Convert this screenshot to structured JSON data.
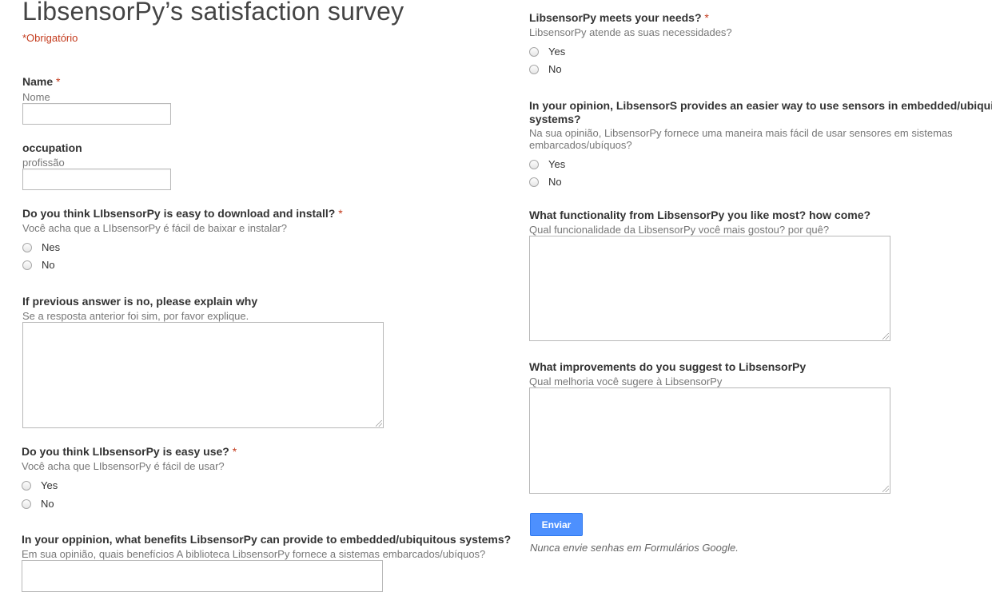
{
  "form": {
    "title": "LibsensorPy’s satisfaction survey",
    "required_note": "*Obrigatório",
    "required_star": "*",
    "left": {
      "name": {
        "label": "Name",
        "help": "Nome"
      },
      "occupation": {
        "label": "occupation",
        "help": "profissão"
      },
      "easy_install": {
        "label": "Do you think LIbsensorPy is easy to download and install?",
        "help": "Você acha que a LIbsensorPy é fácil de baixar e instalar?",
        "options": [
          "Nes",
          "No"
        ]
      },
      "explain_why": {
        "label": "If previous answer is no, please explain why",
        "help": "Se a resposta anterior foi sim, por favor explique."
      },
      "easy_use": {
        "label": "Do you think LIbsensorPy is easy use?",
        "help": "Você acha que LIbsensorPy é fácil de usar?",
        "options": [
          "Yes",
          "No"
        ]
      },
      "benefits": {
        "label": "In your oppinion, what benefits LibsensorPy can provide to embedded/ubiquitous systems?",
        "help": "Em sua opinião, quais benefícios A biblioteca LibsensorPy fornece a sistemas embarcados/ubíquos?"
      }
    },
    "right": {
      "meets_needs": {
        "label": "LibsensorPy meets your needs?",
        "help": "LibsensorPy atende as suas necessidades?",
        "options": [
          "Yes",
          "No"
        ]
      },
      "easier_way": {
        "label_line1": "In your opinion, LibsensorS provides an easier way to use sensors in embedded/ubiquitous",
        "label_line2": "systems?",
        "help_line1": "Na sua opinião, LibsensorPy fornece uma maneira mais fácil de usar sensores em sistemas",
        "help_line2": "embarcados/ubíquos?",
        "options": [
          "Yes",
          "No"
        ]
      },
      "functionality": {
        "label": "What functionality from LibsensorPy you like most? how come?",
        "help": "Qual funcionalidade da LibsensorPy você mais gostou? por quê?"
      },
      "improvements": {
        "label": "What improvements do you suggest to LibsensorPy",
        "help": "Qual melhoria você sugere à LibsensorPy"
      }
    },
    "submit_label": "Enviar",
    "footer_note": "Nunca envie senhas em Formulários Google.",
    "colors": {
      "required": "#c43b1d",
      "button": "#4d90fe",
      "help_text": "#777777"
    }
  }
}
